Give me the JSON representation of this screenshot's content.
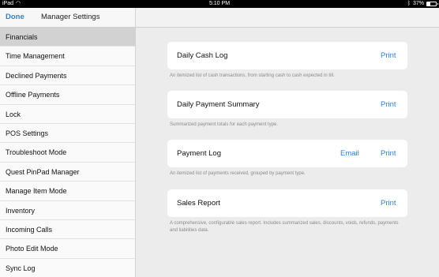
{
  "status_bar": {
    "device": "iPad",
    "time": "5:10 PM",
    "battery_text": "37%",
    "battery_level": 0.37
  },
  "nav": {
    "done_label": "Done",
    "title": "Manager Settings"
  },
  "sidebar": {
    "selected": "Financials",
    "items": [
      {
        "label": "Financials"
      },
      {
        "label": "Time Management"
      },
      {
        "label": "Declined Payments"
      },
      {
        "label": "Offline Payments"
      },
      {
        "label": "Lock"
      },
      {
        "label": "POS Settings"
      },
      {
        "label": "Troubleshoot Mode"
      },
      {
        "label": "Quest PinPad Manager"
      },
      {
        "label": "Manage Item Mode"
      },
      {
        "label": "Inventory"
      },
      {
        "label": "Incoming Calls"
      },
      {
        "label": "Photo Edit Mode"
      },
      {
        "label": "Sync Log"
      }
    ]
  },
  "reports": [
    {
      "title": "Daily Cash Log",
      "print_label": "Print",
      "description": "An itemized list of cash transactions, from starting cash to cash expected in till."
    },
    {
      "title": "Daily Payment Summary",
      "print_label": "Print",
      "description": "Summarized payment totals for each payment type."
    },
    {
      "title": "Payment Log",
      "email_label": "Email",
      "print_label": "Print",
      "description": "An itemized list of payments received, grouped by payment type."
    },
    {
      "title": "Sales Report",
      "print_label": "Print",
      "description": "A comprehensive, configurable sales report. Includes summarized sales, discounts, voids, refunds, payments and liabilities data."
    }
  ],
  "colors": {
    "accent": "#2d82e0",
    "selected_row": "#d2d2d2",
    "background": "#ececec"
  }
}
